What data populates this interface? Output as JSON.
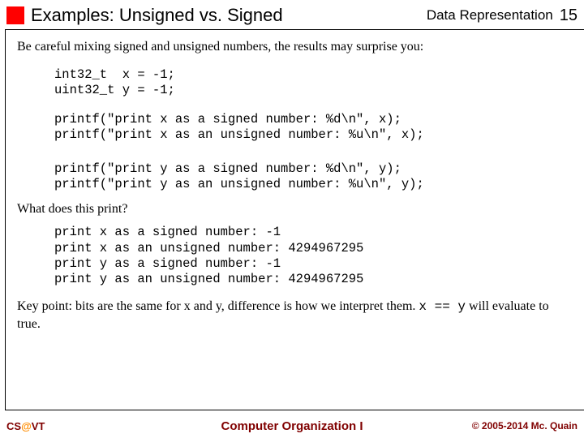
{
  "header": {
    "title": "Examples: Unsigned vs. Signed",
    "chapter": "Data Representation",
    "pagenum": "15"
  },
  "intro": "Be careful mixing signed and unsigned numbers, the results may surprise you:",
  "code": {
    "decl": "int32_t  x = -1;\nuint32_t y = -1;",
    "printx": "printf(\"print x as a signed number: %d\\n\", x);\nprintf(\"print x as an unsigned number: %u\\n\", x);",
    "printy": "printf(\"print y as a signed number: %d\\n\", y);\nprintf(\"print y as an unsigned number: %u\\n\", y);"
  },
  "question": "What does this print?",
  "output": "print x as a signed number: -1\nprint x as an unsigned number: 4294967295\nprint y as a signed number: -1\nprint y as an unsigned number: 4294967295",
  "keypoint_prefix": "Key point: bits are the same for x and y, difference is how we interpret them. ",
  "keypoint_code": "x == y",
  "keypoint_suffix": " will evaluate to true.",
  "footer": {
    "left_cs": "CS",
    "left_at": "@",
    "left_vt": "VT",
    "center": "Computer Organization I",
    "right": "© 2005-2014 Mc. Quain"
  }
}
